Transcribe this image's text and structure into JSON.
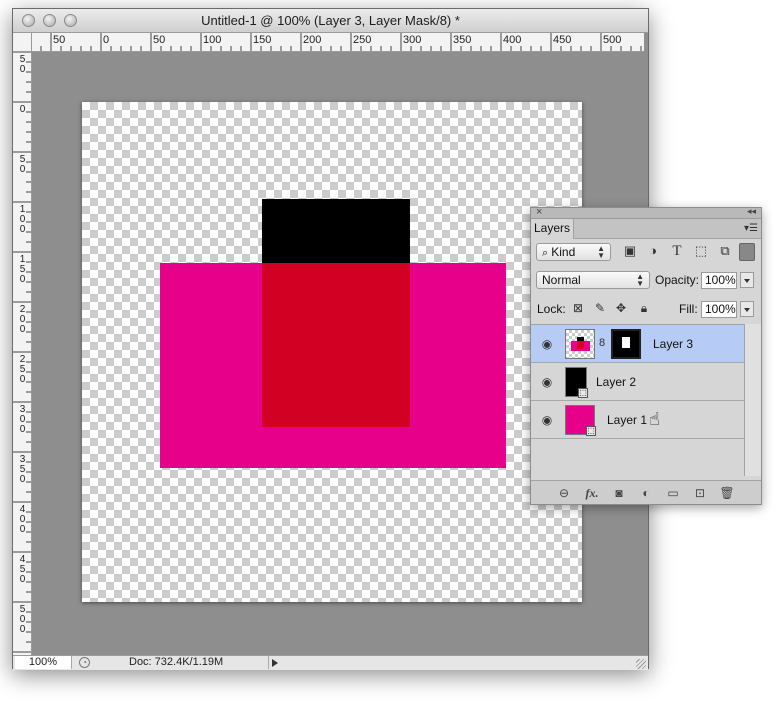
{
  "window": {
    "title": "Untitled-1 @ 100% (Layer 3, Layer Mask/8) *"
  },
  "rulers": {
    "top": [
      "50",
      "0",
      "50",
      "100",
      "150",
      "200",
      "250",
      "300",
      "350",
      "400",
      "450",
      "500"
    ],
    "left": [
      "5\n0",
      "0",
      "5\n0",
      "1\n0\n0",
      "1\n5\n0",
      "2\n0\n0",
      "2\n5\n0",
      "3\n0\n0",
      "3\n5\n0",
      "4\n0\n0",
      "4\n5\n0",
      "5\n0\n0"
    ]
  },
  "status": {
    "zoom": "100%",
    "doc_info": "Doc: 732.4K/1.19M"
  },
  "colors": {
    "magenta": "#e6008a",
    "red": "#d20022",
    "black": "#000000"
  },
  "layers_panel": {
    "tab": "Layers",
    "filter": "Kind",
    "blend_mode": "Normal",
    "opacity_label": "Opacity:",
    "opacity_value": "100%",
    "lock_label": "Lock:",
    "fill_label": "Fill:",
    "fill_value": "100%",
    "layers": [
      {
        "name": "Layer 3",
        "selected": true
      },
      {
        "name": "Layer 2",
        "selected": false
      },
      {
        "name": "Layer 1",
        "selected": false
      }
    ]
  }
}
